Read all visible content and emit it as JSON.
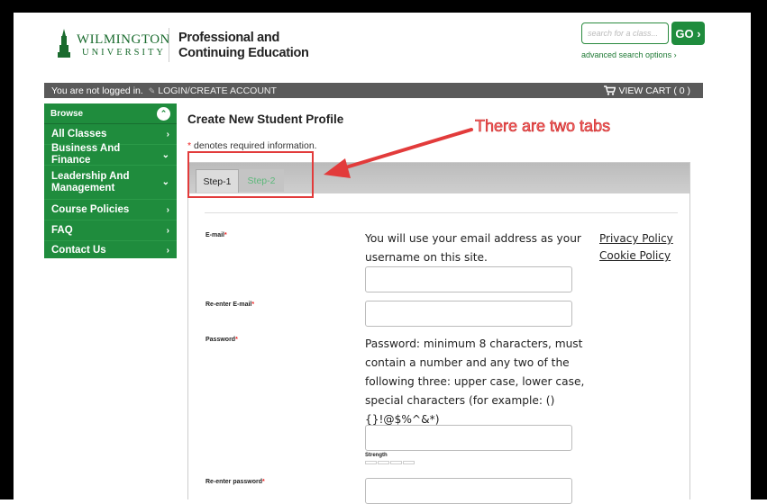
{
  "header": {
    "logo_line1": "WILMINGTON",
    "logo_line2": "UNIVERSITY",
    "title_line1": "Professional and",
    "title_line2": "Continuing Education",
    "search_placeholder": "search for a class...",
    "go_label": "GO ›",
    "advanced_search": "advanced search options ›"
  },
  "topbar": {
    "login_status": "You are not logged in.",
    "login_link": "LOGIN/CREATE ACCOUNT",
    "cart": "VIEW CART ( 0 )"
  },
  "sidebar": {
    "heading": "Browse",
    "items": [
      {
        "label": "All Classes",
        "arrow": "›"
      },
      {
        "label": "Business And Finance",
        "arrow": "⌄"
      },
      {
        "label": "Leadership And Management",
        "arrow": "⌄"
      },
      {
        "label": "Course Policies",
        "arrow": "›"
      },
      {
        "label": "FAQ",
        "arrow": "›"
      },
      {
        "label": "Contact Us",
        "arrow": "›"
      }
    ]
  },
  "main": {
    "title": "Create New Student Profile",
    "required_note": " denotes required information.",
    "tabs": [
      "Step-1",
      "Step-2"
    ],
    "fields": {
      "email_label": "E-mail",
      "email_help": "You will use your email address as your username on this site.",
      "reenter_email_label": "Re-enter E-mail",
      "password_label": "Password",
      "password_help": "Password: minimum 8 characters, must contain a number and any two of the following three: upper case, lower case, special characters (for example: (){}!@$%^&*)",
      "strength_label": "Strength",
      "reenter_password_label": "Re-enter password"
    },
    "links": {
      "privacy": "Privacy Policy",
      "cookie": "Cookie Policy"
    }
  },
  "annotation": {
    "text": "There are two tabs"
  },
  "colors": {
    "brand_green": "#1f8c3d",
    "annotation_red": "#e23b3b"
  }
}
